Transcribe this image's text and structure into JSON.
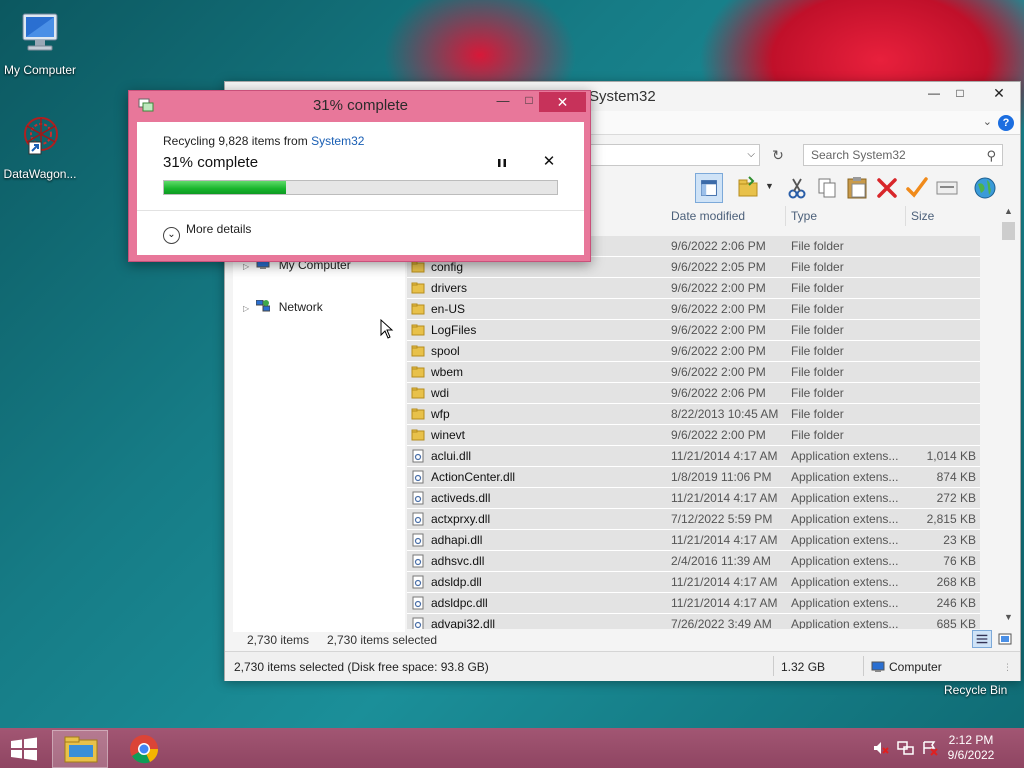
{
  "desktop": {
    "icons": [
      {
        "label": "My Computer"
      },
      {
        "label": "DataWagon..."
      }
    ],
    "recycle_bin_label": "Recycle Bin"
  },
  "explorer": {
    "title": "System32",
    "address_segment": "32",
    "search_placeholder": "Search System32",
    "columns": [
      "Date modified",
      "Type",
      "Size"
    ],
    "nav": [
      {
        "label": "My Computer"
      },
      {
        "label": "Network"
      }
    ],
    "rows": [
      {
        "name": "",
        "date": "9/6/2022 2:06 PM",
        "type": "File folder",
        "size": "",
        "kind": "folder"
      },
      {
        "name": "config",
        "date": "9/6/2022 2:05 PM",
        "type": "File folder",
        "size": "",
        "kind": "folder"
      },
      {
        "name": "drivers",
        "date": "9/6/2022 2:00 PM",
        "type": "File folder",
        "size": "",
        "kind": "folder"
      },
      {
        "name": "en-US",
        "date": "9/6/2022 2:00 PM",
        "type": "File folder",
        "size": "",
        "kind": "folder"
      },
      {
        "name": "LogFiles",
        "date": "9/6/2022 2:00 PM",
        "type": "File folder",
        "size": "",
        "kind": "folder"
      },
      {
        "name": "spool",
        "date": "9/6/2022 2:00 PM",
        "type": "File folder",
        "size": "",
        "kind": "folder"
      },
      {
        "name": "wbem",
        "date": "9/6/2022 2:00 PM",
        "type": "File folder",
        "size": "",
        "kind": "folder"
      },
      {
        "name": "wdi",
        "date": "9/6/2022 2:06 PM",
        "type": "File folder",
        "size": "",
        "kind": "folder"
      },
      {
        "name": "wfp",
        "date": "8/22/2013 10:45 AM",
        "type": "File folder",
        "size": "",
        "kind": "folder"
      },
      {
        "name": "winevt",
        "date": "9/6/2022 2:00 PM",
        "type": "File folder",
        "size": "",
        "kind": "folder"
      },
      {
        "name": "aclui.dll",
        "date": "11/21/2014 4:17 AM",
        "type": "Application extens...",
        "size": "1,014 KB",
        "kind": "dll"
      },
      {
        "name": "ActionCenter.dll",
        "date": "1/8/2019 11:06 PM",
        "type": "Application extens...",
        "size": "874 KB",
        "kind": "dll"
      },
      {
        "name": "activeds.dll",
        "date": "11/21/2014 4:17 AM",
        "type": "Application extens...",
        "size": "272 KB",
        "kind": "dll"
      },
      {
        "name": "actxprxy.dll",
        "date": "7/12/2022 5:59 PM",
        "type": "Application extens...",
        "size": "2,815 KB",
        "kind": "dll"
      },
      {
        "name": "adhapi.dll",
        "date": "11/21/2014 4:17 AM",
        "type": "Application extens...",
        "size": "23 KB",
        "kind": "dll"
      },
      {
        "name": "adhsvc.dll",
        "date": "2/4/2016 11:39 AM",
        "type": "Application extens...",
        "size": "76 KB",
        "kind": "dll"
      },
      {
        "name": "adsldp.dll",
        "date": "11/21/2014 4:17 AM",
        "type": "Application extens...",
        "size": "268 KB",
        "kind": "dll"
      },
      {
        "name": "adsldpc.dll",
        "date": "11/21/2014 4:17 AM",
        "type": "Application extens...",
        "size": "246 KB",
        "kind": "dll"
      },
      {
        "name": "advapi32.dll",
        "date": "7/26/2022 3:49 AM",
        "type": "Application extens...",
        "size": "685 KB",
        "kind": "dll"
      }
    ],
    "item_count": "2,730 items",
    "selected_count": "2,730 items selected",
    "status_text": "2,730 items selected (Disk free space: 93.8 GB)",
    "status_size": "1.32 GB",
    "status_location": "Computer"
  },
  "progress": {
    "title": "31% complete",
    "desc_prefix": "Recycling 9,828 items from ",
    "desc_link": "System32",
    "percent_label": "31% complete",
    "percent_value": 31,
    "more_details": "More details"
  },
  "taskbar": {
    "time": "2:12 PM",
    "date": "9/6/2022"
  },
  "colors": {
    "accent_pink": "#e8779a",
    "progress_green": "#17b52c",
    "link_blue": "#1a5fb4"
  }
}
